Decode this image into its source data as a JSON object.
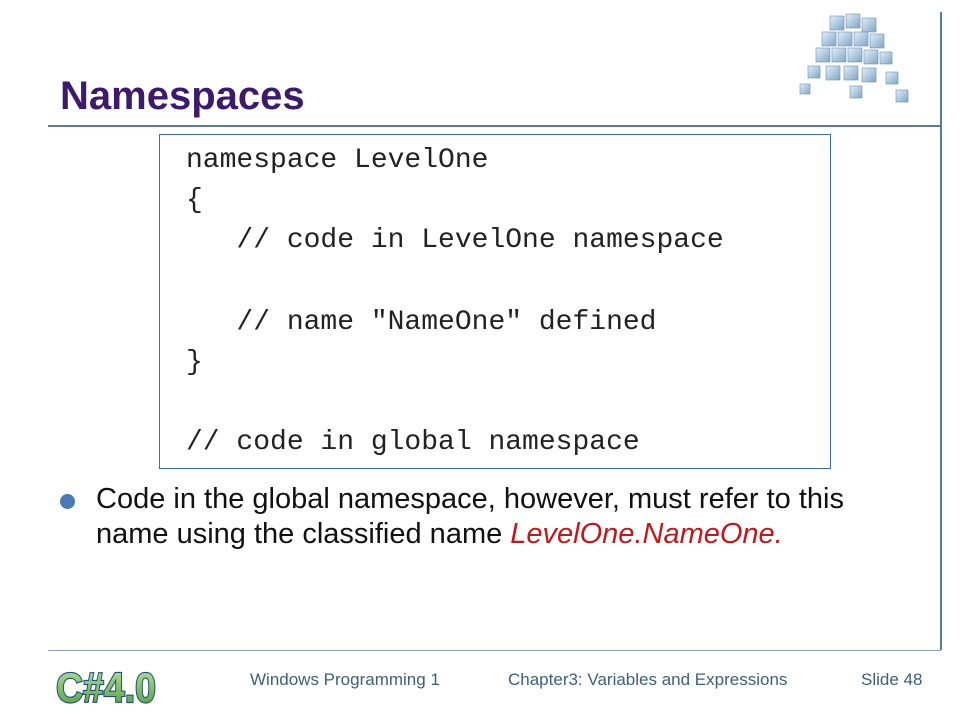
{
  "slide": {
    "title": "Namespaces"
  },
  "code": {
    "lines": [
      "namespace LevelOne",
      "{",
      "   // code in LevelOne namespace",
      "",
      "   // name \"NameOne\" defined",
      "}",
      "",
      "// code in global namespace"
    ]
  },
  "bullet": {
    "text": "Code in the global namespace, however, must refer to this name using the classified name ",
    "highlight": "LevelOne.NameOne."
  },
  "footer": {
    "logo_text": "C#4.0",
    "course": "Windows Programming 1",
    "chapter": "Chapter3: Variables and Expressions",
    "slide_number": "Slide 48"
  },
  "colors": {
    "title": "#3d1a6b",
    "highlight": "#c0181c",
    "box_border": "#3a6db5",
    "footer_text": "#3e5f7c"
  },
  "icons": {
    "header_graphic": "cube-stack-icon",
    "bullet": "bullet-dot-icon"
  }
}
